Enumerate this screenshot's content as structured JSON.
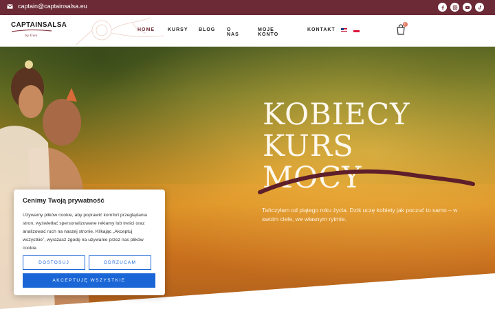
{
  "topbar": {
    "email": "captain@captainsalsa.eu"
  },
  "social": [
    "facebook-icon",
    "instagram-icon",
    "youtube-icon",
    "tiktok-icon"
  ],
  "logo": {
    "name": "CAPTAINSALSA",
    "by": "by Ewa"
  },
  "nav": {
    "items": [
      "HOME",
      "KURSY",
      "BLOG",
      "O NAS",
      "MOJE KONTO",
      "KONTAKT"
    ]
  },
  "cart": {
    "count": "0"
  },
  "hero": {
    "title_lines": [
      "KOBIECY",
      "KURS",
      "MOCY"
    ],
    "subtitle": "Tańczyłam od piątego roku życia. Dziś uczę kobiety jak poczuć to samo – w swoim ciele, we własnym rytmie."
  },
  "cookie": {
    "title": "Cenimy Twoją prywatność",
    "text": "Używamy plików cookie, aby poprawić komfort przeglądania stron, wyświetlać spersonalizowane reklamy lub treści oraz analizować ruch na naszej stronie. Klikając „Akceptuj wszystkie”, wyrażasz zgodę na używanie przez nas plików cookie.",
    "customize": "DOSTOSUJ",
    "reject": "ODRZUCAM",
    "accept": "AKCEPTUJĘ WSZYSTKIE"
  },
  "colors": {
    "brand": "#6b2a35",
    "accent": "#1a66d6"
  }
}
